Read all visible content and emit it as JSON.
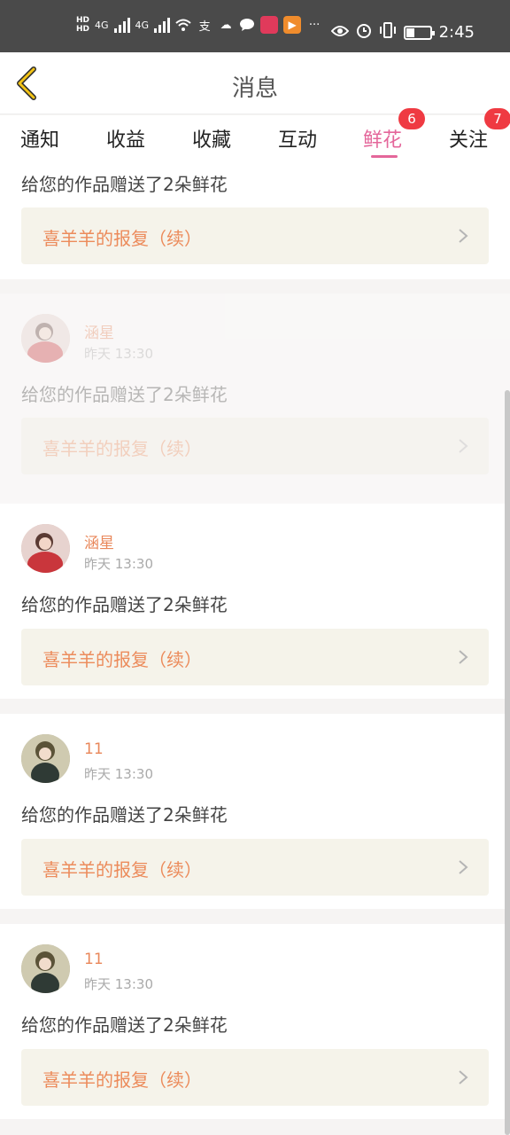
{
  "status_bar": {
    "hd1": "HD",
    "hd2": "HD",
    "net1": "4G",
    "net2": "4G",
    "time": "2:45",
    "battery_level": 0.35
  },
  "header": {
    "title": "消息"
  },
  "tabs": [
    {
      "label": "通知"
    },
    {
      "label": "收益"
    },
    {
      "label": "收藏"
    },
    {
      "label": "互动"
    },
    {
      "label": "鲜花",
      "badge": "6"
    },
    {
      "label": "关注",
      "badge": "7"
    }
  ],
  "items": [
    {
      "user": "",
      "time": "",
      "message": "给您的作品赠送了2朵鲜花",
      "work": "喜羊羊的报复（续）"
    },
    {
      "user": "涵星",
      "time": "昨天 13:30",
      "message": "给您的作品赠送了2朵鲜花",
      "work": "喜羊羊的报复（续）"
    },
    {
      "user": "涵星",
      "time": "昨天 13:30",
      "message": "给您的作品赠送了2朵鲜花",
      "work": "喜羊羊的报复（续）"
    },
    {
      "user": "11",
      "time": "昨天 13:30",
      "message": "给您的作品赠送了2朵鲜花",
      "work": "喜羊羊的报复（续）"
    },
    {
      "user": "11",
      "time": "昨天 13:30",
      "message": "给您的作品赠送了2朵鲜花",
      "work": "喜羊羊的报复（续）"
    }
  ],
  "colors": {
    "accent": "#e4669a",
    "badge": "#ef3a42",
    "username": "#e9875a",
    "work_title": "#ec8b5b"
  }
}
